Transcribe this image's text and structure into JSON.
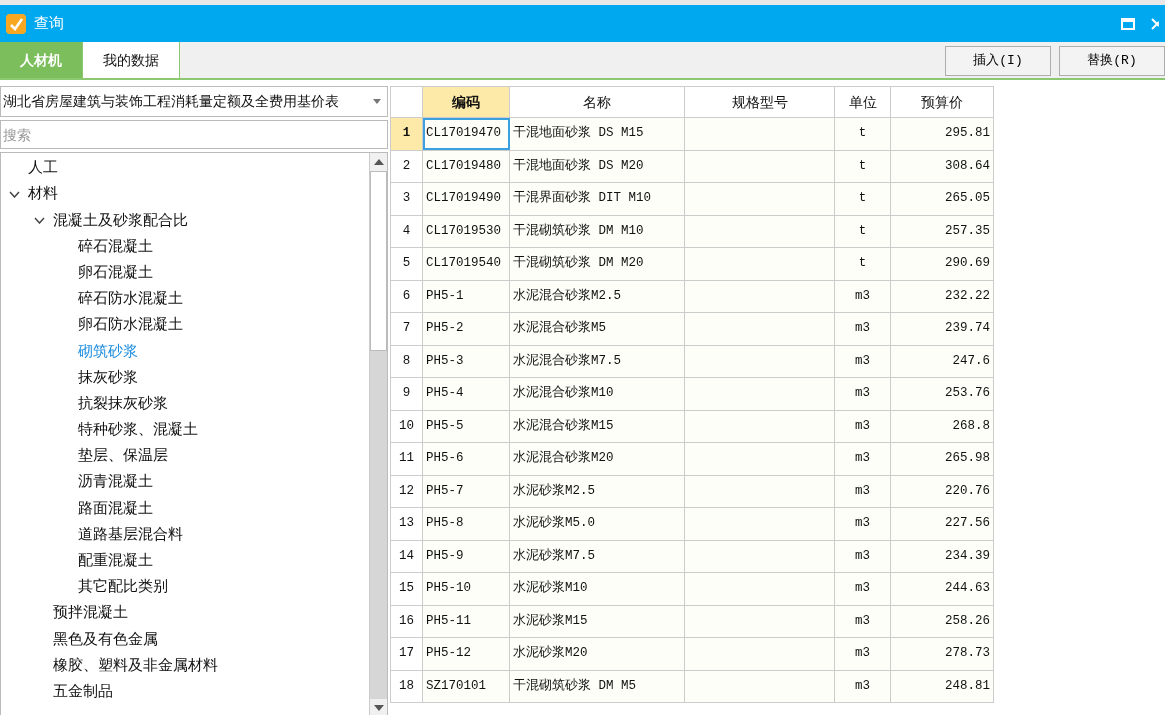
{
  "window": {
    "title": "查询"
  },
  "tabs": [
    {
      "label": "人材机",
      "selected": true
    },
    {
      "label": "我的数据",
      "selected": false
    }
  ],
  "buttons": [
    "插入(I)",
    "替换(R)"
  ],
  "library": {
    "value": "湖北省房屋建筑与装饰工程消耗量定额及全费用基价表"
  },
  "search": {
    "placeholder": "搜索"
  },
  "tree": [
    {
      "label": "人工",
      "selected": false
    },
    {
      "label": "材料",
      "selected": false,
      "expanded": true,
      "children": [
        {
          "label": "混凝土及砂浆配合比",
          "selected": false,
          "expanded": true,
          "children": [
            {
              "label": "碎石混凝土",
              "selected": false
            },
            {
              "label": "卵石混凝土",
              "selected": false
            },
            {
              "label": "碎石防水混凝土",
              "selected": false
            },
            {
              "label": "卵石防水混凝土",
              "selected": false
            },
            {
              "label": "砌筑砂浆",
              "selected": true
            },
            {
              "label": "抹灰砂浆",
              "selected": false
            },
            {
              "label": "抗裂抹灰砂浆",
              "selected": false
            },
            {
              "label": "特种砂浆、混凝土",
              "selected": false
            },
            {
              "label": "垫层、保温层",
              "selected": false
            },
            {
              "label": "沥青混凝土",
              "selected": false
            },
            {
              "label": "路面混凝土",
              "selected": false
            },
            {
              "label": "道路基层混合料",
              "selected": false
            },
            {
              "label": "配重混凝土",
              "selected": false
            },
            {
              "label": "其它配比类别",
              "selected": false
            }
          ]
        },
        {
          "label": "预拌混凝土",
          "selected": false
        },
        {
          "label": "黑色及有色金属",
          "selected": false
        },
        {
          "label": "橡胶、塑料及非金属材料",
          "selected": false
        },
        {
          "label": "五金制品",
          "selected": false
        }
      ]
    }
  ],
  "table": {
    "columns": [
      "编码",
      "名称",
      "规格型号",
      "单位",
      "预算价"
    ],
    "rows": [
      {
        "no": "1",
        "code": "CL17019470",
        "name": "干混地面砂浆 DS M15",
        "unit": "t",
        "price": "295.81",
        "selected": true
      },
      {
        "no": "2",
        "code": "CL17019480",
        "name": "干混地面砂浆 DS M20",
        "unit": "t",
        "price": "308.64",
        "selected": false
      },
      {
        "no": "3",
        "code": "CL17019490",
        "name": "干混界面砂浆 DIT M10",
        "unit": "t",
        "price": "265.05",
        "selected": false
      },
      {
        "no": "4",
        "code": "CL17019530",
        "name": "干混砌筑砂浆 DM M10",
        "unit": "t",
        "price": "257.35",
        "selected": false
      },
      {
        "no": "5",
        "code": "CL17019540",
        "name": "干混砌筑砂浆 DM M20",
        "unit": "t",
        "price": "290.69",
        "selected": false
      },
      {
        "no": "6",
        "code": "PH5-1",
        "name": "水泥混合砂浆M2.5",
        "unit": "m3",
        "price": "232.22",
        "selected": false
      },
      {
        "no": "7",
        "code": "PH5-2",
        "name": "水泥混合砂浆M5",
        "unit": "m3",
        "price": "239.74",
        "selected": false
      },
      {
        "no": "8",
        "code": "PH5-3",
        "name": "水泥混合砂浆M7.5",
        "unit": "m3",
        "price": "247.6",
        "selected": false
      },
      {
        "no": "9",
        "code": "PH5-4",
        "name": "水泥混合砂浆M10",
        "unit": "m3",
        "price": "253.76",
        "selected": false
      },
      {
        "no": "10",
        "code": "PH5-5",
        "name": "水泥混合砂浆M15",
        "unit": "m3",
        "price": "268.8",
        "selected": false
      },
      {
        "no": "11",
        "code": "PH5-6",
        "name": "水泥混合砂浆M20",
        "unit": "m3",
        "price": "265.98",
        "selected": false
      },
      {
        "no": "12",
        "code": "PH5-7",
        "name": "水泥砂浆M2.5",
        "unit": "m3",
        "price": "220.76",
        "selected": false
      },
      {
        "no": "13",
        "code": "PH5-8",
        "name": "水泥砂浆M5.0",
        "unit": "m3",
        "price": "227.56",
        "selected": false
      },
      {
        "no": "14",
        "code": "PH5-9",
        "name": "水泥砂浆M7.5",
        "unit": "m3",
        "price": "234.39",
        "selected": false
      },
      {
        "no": "15",
        "code": "PH5-10",
        "name": "水泥砂浆M10",
        "unit": "m3",
        "price": "244.63",
        "selected": false
      },
      {
        "no": "16",
        "code": "PH5-11",
        "name": "水泥砂浆M15",
        "unit": "m3",
        "price": "258.26",
        "selected": false
      },
      {
        "no": "17",
        "code": "PH5-12",
        "name": "水泥砂浆M20",
        "unit": "m3",
        "price": "278.73",
        "selected": false
      },
      {
        "no": "18",
        "code": "SZ170101",
        "name": "干混砌筑砂浆 DM M5",
        "unit": "m3",
        "price": "248.81",
        "selected": false
      }
    ]
  }
}
